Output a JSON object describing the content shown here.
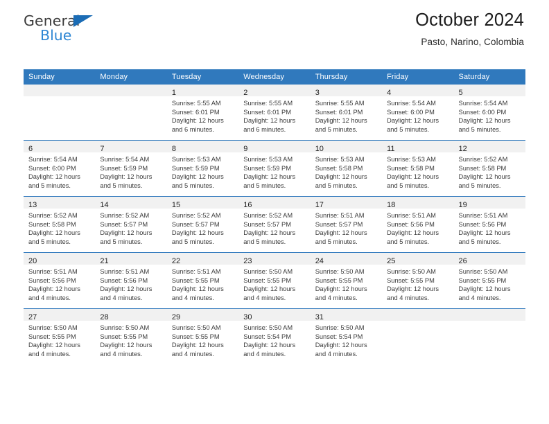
{
  "brand": {
    "name_top": "General",
    "name_bottom": "Blue",
    "triangle_color": "#1b6cb5",
    "blue_text_color": "#2f87d4"
  },
  "header": {
    "title": "October 2024",
    "subtitle": "Pasto, Narino, Colombia"
  },
  "colors": {
    "header_row_bg": "#3079bd",
    "header_row_text": "#ffffff",
    "daynum_band_bg": "#f1f1f1",
    "week_divider": "#3079bd",
    "cell_bg": "#ffffff",
    "body_text": "#3a3a3a"
  },
  "weekday_headers": [
    "Sunday",
    "Monday",
    "Tuesday",
    "Wednesday",
    "Thursday",
    "Friday",
    "Saturday"
  ],
  "weeks": [
    [
      {
        "day": "",
        "sunrise": "",
        "sunset": "",
        "daylight_line1": "",
        "daylight_line2": ""
      },
      {
        "day": "",
        "sunrise": "",
        "sunset": "",
        "daylight_line1": "",
        "daylight_line2": ""
      },
      {
        "day": "1",
        "sunrise": "Sunrise: 5:55 AM",
        "sunset": "Sunset: 6:01 PM",
        "daylight_line1": "Daylight: 12 hours",
        "daylight_line2": "and 6 minutes."
      },
      {
        "day": "2",
        "sunrise": "Sunrise: 5:55 AM",
        "sunset": "Sunset: 6:01 PM",
        "daylight_line1": "Daylight: 12 hours",
        "daylight_line2": "and 6 minutes."
      },
      {
        "day": "3",
        "sunrise": "Sunrise: 5:55 AM",
        "sunset": "Sunset: 6:01 PM",
        "daylight_line1": "Daylight: 12 hours",
        "daylight_line2": "and 5 minutes."
      },
      {
        "day": "4",
        "sunrise": "Sunrise: 5:54 AM",
        "sunset": "Sunset: 6:00 PM",
        "daylight_line1": "Daylight: 12 hours",
        "daylight_line2": "and 5 minutes."
      },
      {
        "day": "5",
        "sunrise": "Sunrise: 5:54 AM",
        "sunset": "Sunset: 6:00 PM",
        "daylight_line1": "Daylight: 12 hours",
        "daylight_line2": "and 5 minutes."
      }
    ],
    [
      {
        "day": "6",
        "sunrise": "Sunrise: 5:54 AM",
        "sunset": "Sunset: 6:00 PM",
        "daylight_line1": "Daylight: 12 hours",
        "daylight_line2": "and 5 minutes."
      },
      {
        "day": "7",
        "sunrise": "Sunrise: 5:54 AM",
        "sunset": "Sunset: 5:59 PM",
        "daylight_line1": "Daylight: 12 hours",
        "daylight_line2": "and 5 minutes."
      },
      {
        "day": "8",
        "sunrise": "Sunrise: 5:53 AM",
        "sunset": "Sunset: 5:59 PM",
        "daylight_line1": "Daylight: 12 hours",
        "daylight_line2": "and 5 minutes."
      },
      {
        "day": "9",
        "sunrise": "Sunrise: 5:53 AM",
        "sunset": "Sunset: 5:59 PM",
        "daylight_line1": "Daylight: 12 hours",
        "daylight_line2": "and 5 minutes."
      },
      {
        "day": "10",
        "sunrise": "Sunrise: 5:53 AM",
        "sunset": "Sunset: 5:58 PM",
        "daylight_line1": "Daylight: 12 hours",
        "daylight_line2": "and 5 minutes."
      },
      {
        "day": "11",
        "sunrise": "Sunrise: 5:53 AM",
        "sunset": "Sunset: 5:58 PM",
        "daylight_line1": "Daylight: 12 hours",
        "daylight_line2": "and 5 minutes."
      },
      {
        "day": "12",
        "sunrise": "Sunrise: 5:52 AM",
        "sunset": "Sunset: 5:58 PM",
        "daylight_line1": "Daylight: 12 hours",
        "daylight_line2": "and 5 minutes."
      }
    ],
    [
      {
        "day": "13",
        "sunrise": "Sunrise: 5:52 AM",
        "sunset": "Sunset: 5:58 PM",
        "daylight_line1": "Daylight: 12 hours",
        "daylight_line2": "and 5 minutes."
      },
      {
        "day": "14",
        "sunrise": "Sunrise: 5:52 AM",
        "sunset": "Sunset: 5:57 PM",
        "daylight_line1": "Daylight: 12 hours",
        "daylight_line2": "and 5 minutes."
      },
      {
        "day": "15",
        "sunrise": "Sunrise: 5:52 AM",
        "sunset": "Sunset: 5:57 PM",
        "daylight_line1": "Daylight: 12 hours",
        "daylight_line2": "and 5 minutes."
      },
      {
        "day": "16",
        "sunrise": "Sunrise: 5:52 AM",
        "sunset": "Sunset: 5:57 PM",
        "daylight_line1": "Daylight: 12 hours",
        "daylight_line2": "and 5 minutes."
      },
      {
        "day": "17",
        "sunrise": "Sunrise: 5:51 AM",
        "sunset": "Sunset: 5:57 PM",
        "daylight_line1": "Daylight: 12 hours",
        "daylight_line2": "and 5 minutes."
      },
      {
        "day": "18",
        "sunrise": "Sunrise: 5:51 AM",
        "sunset": "Sunset: 5:56 PM",
        "daylight_line1": "Daylight: 12 hours",
        "daylight_line2": "and 5 minutes."
      },
      {
        "day": "19",
        "sunrise": "Sunrise: 5:51 AM",
        "sunset": "Sunset: 5:56 PM",
        "daylight_line1": "Daylight: 12 hours",
        "daylight_line2": "and 5 minutes."
      }
    ],
    [
      {
        "day": "20",
        "sunrise": "Sunrise: 5:51 AM",
        "sunset": "Sunset: 5:56 PM",
        "daylight_line1": "Daylight: 12 hours",
        "daylight_line2": "and 4 minutes."
      },
      {
        "day": "21",
        "sunrise": "Sunrise: 5:51 AM",
        "sunset": "Sunset: 5:56 PM",
        "daylight_line1": "Daylight: 12 hours",
        "daylight_line2": "and 4 minutes."
      },
      {
        "day": "22",
        "sunrise": "Sunrise: 5:51 AM",
        "sunset": "Sunset: 5:55 PM",
        "daylight_line1": "Daylight: 12 hours",
        "daylight_line2": "and 4 minutes."
      },
      {
        "day": "23",
        "sunrise": "Sunrise: 5:50 AM",
        "sunset": "Sunset: 5:55 PM",
        "daylight_line1": "Daylight: 12 hours",
        "daylight_line2": "and 4 minutes."
      },
      {
        "day": "24",
        "sunrise": "Sunrise: 5:50 AM",
        "sunset": "Sunset: 5:55 PM",
        "daylight_line1": "Daylight: 12 hours",
        "daylight_line2": "and 4 minutes."
      },
      {
        "day": "25",
        "sunrise": "Sunrise: 5:50 AM",
        "sunset": "Sunset: 5:55 PM",
        "daylight_line1": "Daylight: 12 hours",
        "daylight_line2": "and 4 minutes."
      },
      {
        "day": "26",
        "sunrise": "Sunrise: 5:50 AM",
        "sunset": "Sunset: 5:55 PM",
        "daylight_line1": "Daylight: 12 hours",
        "daylight_line2": "and 4 minutes."
      }
    ],
    [
      {
        "day": "27",
        "sunrise": "Sunrise: 5:50 AM",
        "sunset": "Sunset: 5:55 PM",
        "daylight_line1": "Daylight: 12 hours",
        "daylight_line2": "and 4 minutes."
      },
      {
        "day": "28",
        "sunrise": "Sunrise: 5:50 AM",
        "sunset": "Sunset: 5:55 PM",
        "daylight_line1": "Daylight: 12 hours",
        "daylight_line2": "and 4 minutes."
      },
      {
        "day": "29",
        "sunrise": "Sunrise: 5:50 AM",
        "sunset": "Sunset: 5:55 PM",
        "daylight_line1": "Daylight: 12 hours",
        "daylight_line2": "and 4 minutes."
      },
      {
        "day": "30",
        "sunrise": "Sunrise: 5:50 AM",
        "sunset": "Sunset: 5:54 PM",
        "daylight_line1": "Daylight: 12 hours",
        "daylight_line2": "and 4 minutes."
      },
      {
        "day": "31",
        "sunrise": "Sunrise: 5:50 AM",
        "sunset": "Sunset: 5:54 PM",
        "daylight_line1": "Daylight: 12 hours",
        "daylight_line2": "and 4 minutes."
      },
      {
        "day": "",
        "sunrise": "",
        "sunset": "",
        "daylight_line1": "",
        "daylight_line2": ""
      },
      {
        "day": "",
        "sunrise": "",
        "sunset": "",
        "daylight_line1": "",
        "daylight_line2": ""
      }
    ]
  ]
}
